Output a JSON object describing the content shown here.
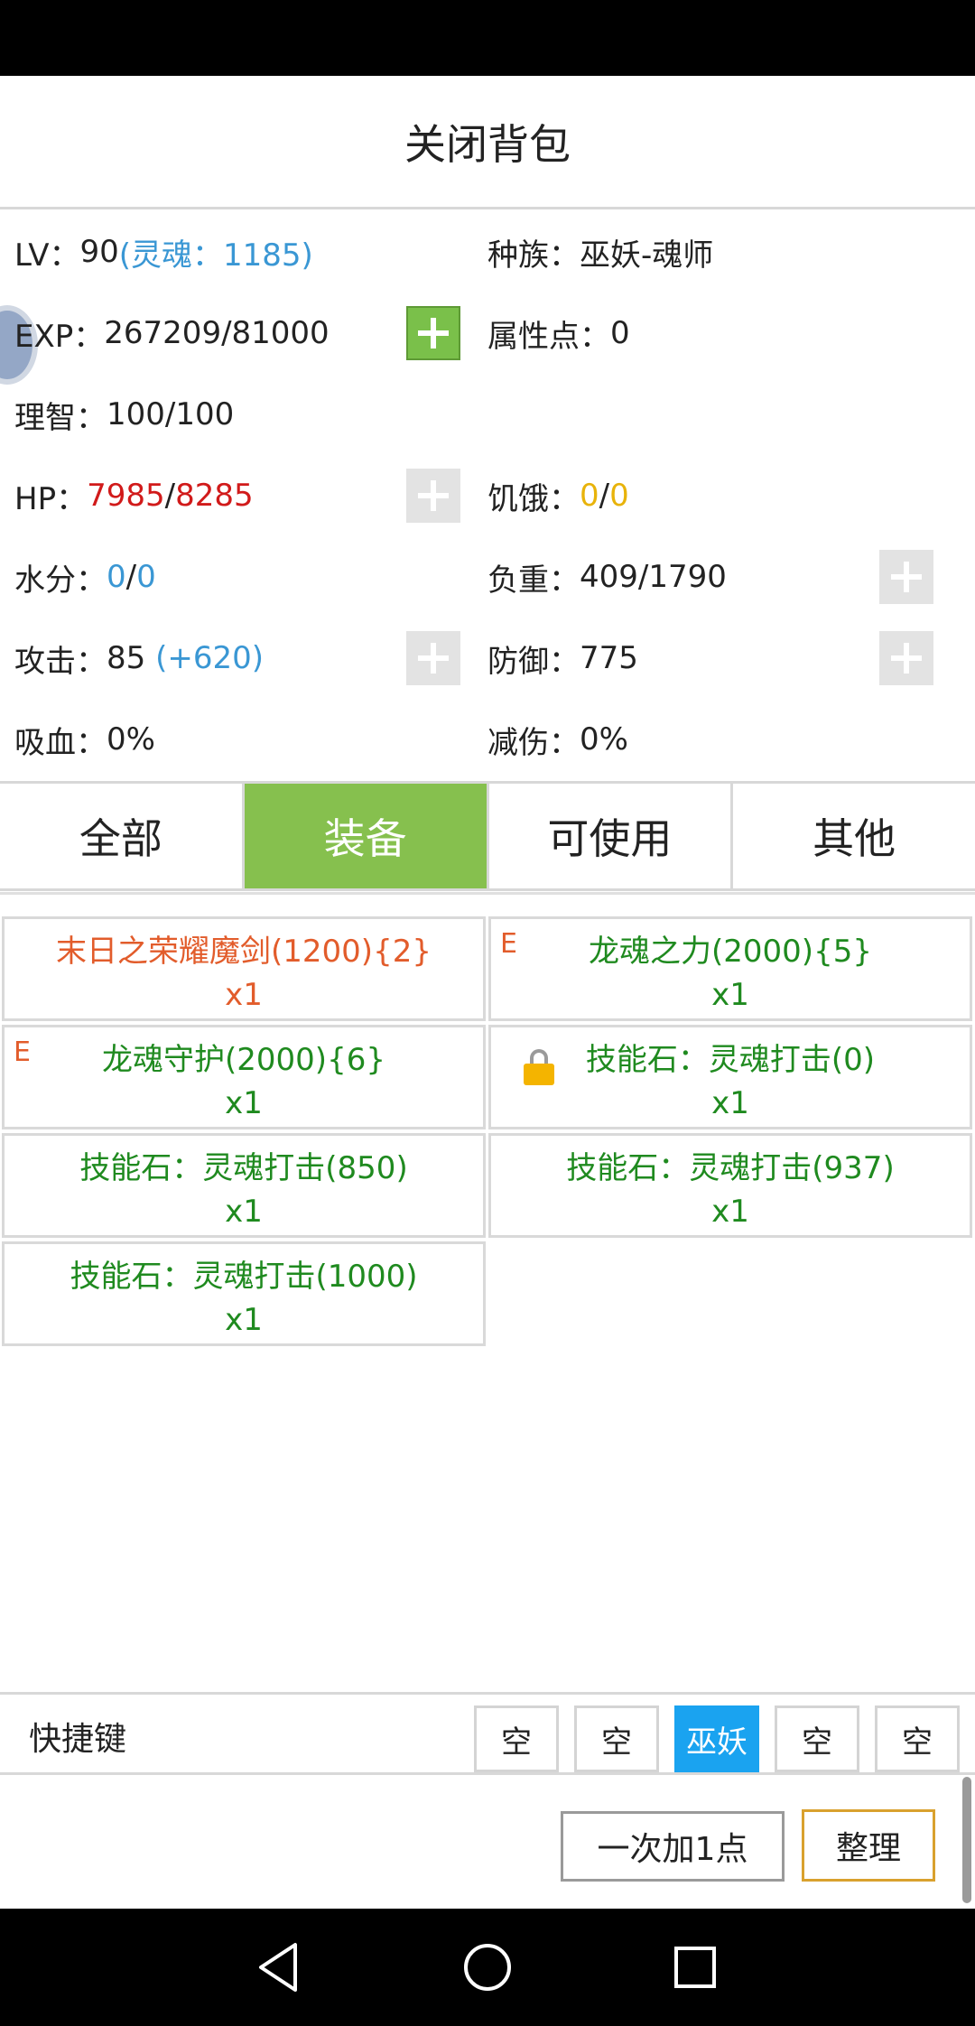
{
  "title": "关闭背包",
  "stats": {
    "lv": {
      "label": "LV：",
      "value": "90",
      "soul": "(灵魂：1185)"
    },
    "race": {
      "label": "种族：",
      "value": "巫妖-魂师"
    },
    "exp": {
      "label": "EXP：",
      "value": "267209/81000"
    },
    "attr_points": {
      "label": "属性点：",
      "value": "0"
    },
    "sanity": {
      "label": "理智：",
      "value": "100/100"
    },
    "hp": {
      "label": "HP：",
      "current": "7985",
      "sep": "/",
      "max": "8285"
    },
    "hunger": {
      "label": "饥饿：",
      "current": "0",
      "sep": "/",
      "max": "0"
    },
    "water": {
      "label": "水分：",
      "current": "0",
      "sep": "/",
      "max": "0"
    },
    "load": {
      "label": "负重：",
      "value": "409/1790"
    },
    "attack": {
      "label": "攻击：",
      "value": "85",
      "bonus": "(+620)"
    },
    "defense": {
      "label": "防御：",
      "value": "775"
    },
    "lifesteal": {
      "label": "吸血：",
      "value": "0%"
    },
    "dmg_reduce": {
      "label": "减伤：",
      "value": "0%"
    }
  },
  "tabs": [
    {
      "label": "全部"
    },
    {
      "label": "装备"
    },
    {
      "label": "可使用"
    },
    {
      "label": "其他"
    }
  ],
  "active_tab": "装备",
  "items": [
    {
      "name": "末日之荣耀魔剑(1200){2}",
      "qty": "x1",
      "color": "#e25c2b"
    },
    {
      "name": "龙魂之力(2000){5}",
      "qty": "x1",
      "color": "#1f8a1f",
      "mark": "E"
    },
    {
      "name": "龙魂守护(2000){6}",
      "qty": "x1",
      "color": "#1f8a1f",
      "mark": "E"
    },
    {
      "name": "技能石：灵魂打击(0)",
      "qty": "x1",
      "color": "#1f8a1f",
      "icon": "lock-icon"
    },
    {
      "name": "技能石：灵魂打击(850)",
      "qty": "x1",
      "color": "#1f8a1f"
    },
    {
      "name": "技能石：灵魂打击(937)",
      "qty": "x1",
      "color": "#1f8a1f"
    },
    {
      "name": "技能石：灵魂打击(1000)",
      "qty": "x1",
      "color": "#1f8a1f"
    }
  ],
  "shortcuts": {
    "label": "快捷键",
    "slots": [
      "空",
      "空",
      "巫妖",
      "空",
      "空"
    ],
    "active_slot": "巫妖"
  },
  "buttons": {
    "add_once": "一次加1点",
    "sort": "整理"
  },
  "nav": [
    "back-icon",
    "home-icon",
    "recents-icon"
  ],
  "colors": {
    "accent_green": "#86c04e",
    "shortcut_active": "#1aa3f0",
    "soul_blue": "#3a97d4",
    "hp_red": "#d11a1a",
    "hunger_yellow": "#e8b30a"
  }
}
